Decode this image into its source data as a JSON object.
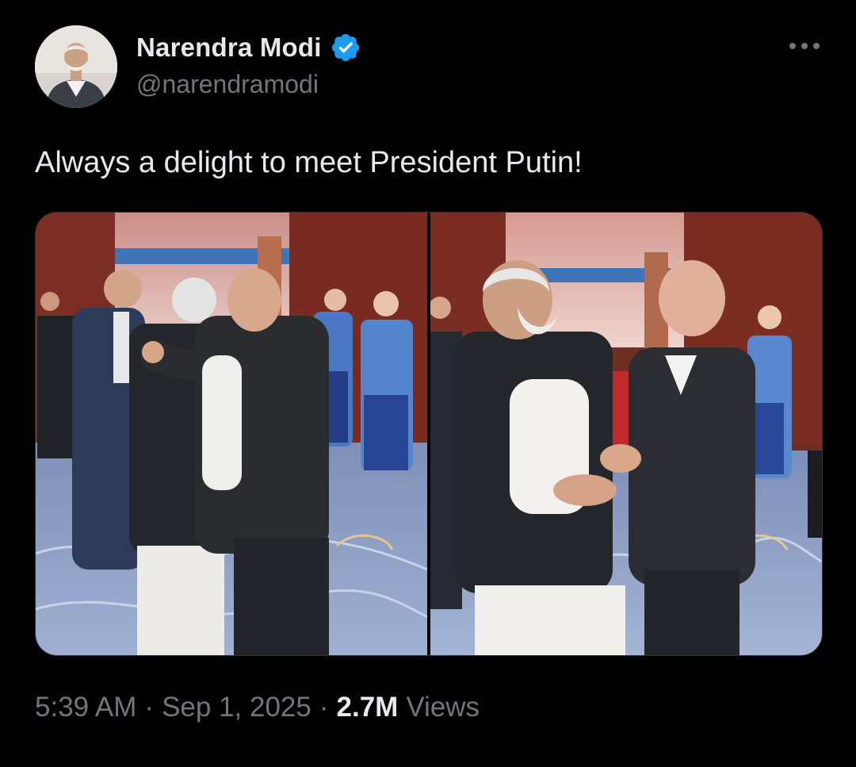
{
  "author": {
    "display_name": "Narendra Modi",
    "handle": "@narendramodi",
    "verified": true,
    "verified_color": "#1d9bf0"
  },
  "tweet": {
    "text": "Always a delight to meet President Putin!",
    "media_count": 2
  },
  "meta": {
    "time": "5:39 AM",
    "separator": "·",
    "date": "Sep 1, 2025",
    "views_count": "2.7M",
    "views_label": "Views"
  },
  "icons": {
    "more": "more-options-icon",
    "verified": "verified-badge-icon"
  },
  "colors": {
    "background": "#000000",
    "primary_text": "#e7e9ea",
    "secondary_text": "#71767b"
  }
}
